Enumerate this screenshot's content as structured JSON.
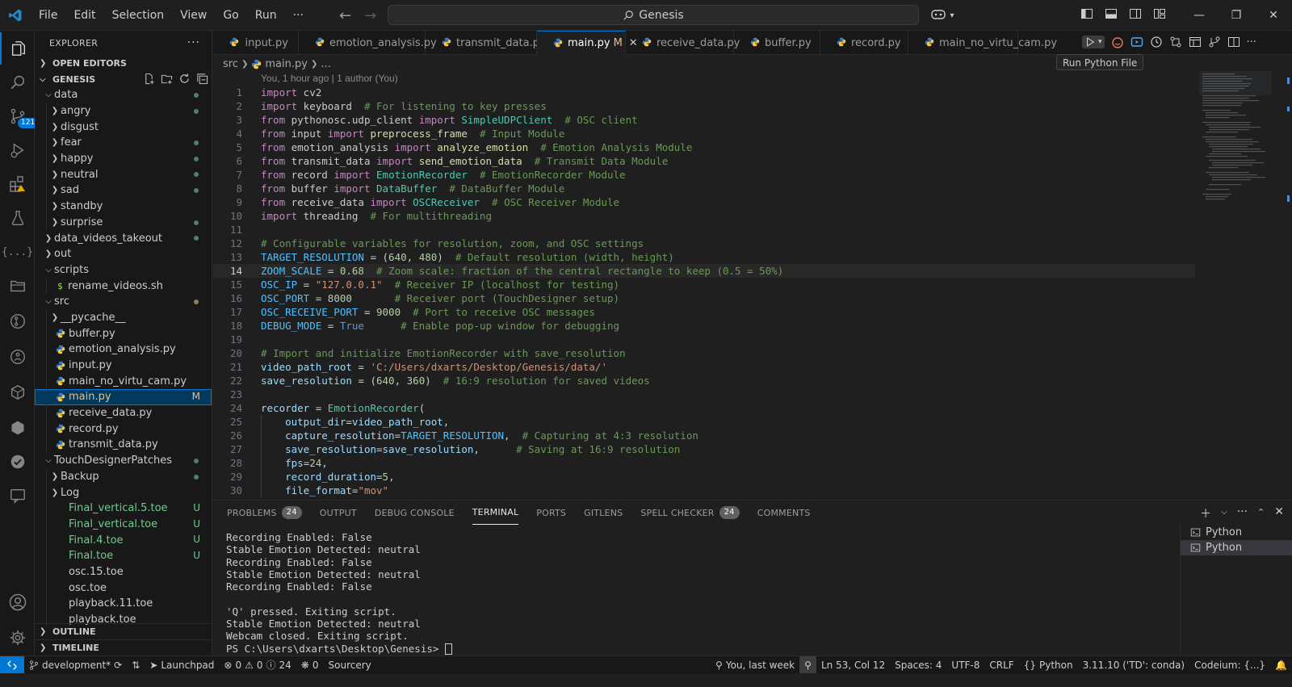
{
  "titlebar": {
    "menu": [
      "File",
      "Edit",
      "Selection",
      "View",
      "Go",
      "Run",
      "···"
    ],
    "search_text": "Genesis"
  },
  "activity": {
    "scm_badge": "121"
  },
  "explorer": {
    "header": "EXPLORER",
    "open_editors": "OPEN EDITORS",
    "root": "GENESIS",
    "tree": [
      {
        "label": "data",
        "depth": 0,
        "type": "folder-open",
        "status": "dot"
      },
      {
        "label": "angry",
        "depth": 1,
        "type": "folder",
        "status": "dot"
      },
      {
        "label": "disgust",
        "depth": 1,
        "type": "folder",
        "status": ""
      },
      {
        "label": "fear",
        "depth": 1,
        "type": "folder",
        "status": "dot"
      },
      {
        "label": "happy",
        "depth": 1,
        "type": "folder",
        "status": "dot"
      },
      {
        "label": "neutral",
        "depth": 1,
        "type": "folder",
        "status": "dot"
      },
      {
        "label": "sad",
        "depth": 1,
        "type": "folder",
        "status": "dot"
      },
      {
        "label": "standby",
        "depth": 1,
        "type": "folder",
        "status": ""
      },
      {
        "label": "surprise",
        "depth": 1,
        "type": "folder",
        "status": "dot"
      },
      {
        "label": "data_videos_takeout",
        "depth": 0,
        "type": "folder",
        "status": "dot"
      },
      {
        "label": "out",
        "depth": 0,
        "type": "folder",
        "status": ""
      },
      {
        "label": "scripts",
        "depth": 0,
        "type": "folder-open",
        "status": ""
      },
      {
        "label": "rename_videos.sh",
        "depth": 1,
        "type": "sh",
        "status": ""
      },
      {
        "label": "src",
        "depth": 0,
        "type": "folder-open",
        "status": "dotmod"
      },
      {
        "label": "__pycache__",
        "depth": 1,
        "type": "folder",
        "status": ""
      },
      {
        "label": "buffer.py",
        "depth": 1,
        "type": "py",
        "status": ""
      },
      {
        "label": "emotion_analysis.py",
        "depth": 1,
        "type": "py",
        "status": ""
      },
      {
        "label": "input.py",
        "depth": 1,
        "type": "py",
        "status": ""
      },
      {
        "label": "main_no_virtu_cam.py",
        "depth": 1,
        "type": "py",
        "status": ""
      },
      {
        "label": "main.py",
        "depth": 1,
        "type": "py",
        "status": "M",
        "selected": true
      },
      {
        "label": "receive_data.py",
        "depth": 1,
        "type": "py",
        "status": ""
      },
      {
        "label": "record.py",
        "depth": 1,
        "type": "py",
        "status": ""
      },
      {
        "label": "transmit_data.py",
        "depth": 1,
        "type": "py",
        "status": ""
      },
      {
        "label": "TouchDesignerPatches",
        "depth": 0,
        "type": "folder-open",
        "status": "dot"
      },
      {
        "label": "Backup",
        "depth": 1,
        "type": "folder",
        "status": "dot"
      },
      {
        "label": "Log",
        "depth": 1,
        "type": "folder",
        "status": ""
      },
      {
        "label": "Final_vertical.5.toe",
        "depth": 1,
        "type": "file-green",
        "status": "U"
      },
      {
        "label": "Final_vertical.toe",
        "depth": 1,
        "type": "file-green",
        "status": "U"
      },
      {
        "label": "Final.4.toe",
        "depth": 1,
        "type": "file-green",
        "status": "U"
      },
      {
        "label": "Final.toe",
        "depth": 1,
        "type": "file-green",
        "status": "U"
      },
      {
        "label": "osc.15.toe",
        "depth": 1,
        "type": "file",
        "status": ""
      },
      {
        "label": "osc.toe",
        "depth": 1,
        "type": "file",
        "status": ""
      },
      {
        "label": "playback.11.toe",
        "depth": 1,
        "type": "file",
        "status": ""
      },
      {
        "label": "playback.toe",
        "depth": 1,
        "type": "file",
        "status": ""
      }
    ],
    "outline": "OUTLINE",
    "timeline": "TIMELINE"
  },
  "tabs": [
    {
      "label": "input.py",
      "active": false,
      "modified": ""
    },
    {
      "label": "emotion_analysis.py",
      "active": false,
      "modified": ""
    },
    {
      "label": "transmit_data.py",
      "active": false,
      "modified": ""
    },
    {
      "label": "main.py",
      "active": true,
      "modified": "M"
    },
    {
      "label": "receive_data.py",
      "active": false,
      "modified": ""
    },
    {
      "label": "buffer.py",
      "active": false,
      "modified": ""
    },
    {
      "label": "record.py",
      "active": false,
      "modified": ""
    },
    {
      "label": "main_no_virtu_cam.py",
      "active": false,
      "modified": ""
    }
  ],
  "tooltip": "Run Python File",
  "breadcrumb": {
    "folder": "src",
    "file": "main.py",
    "more": "..."
  },
  "blame": "You, 1 hour ago | 1 author (You)",
  "code": [
    {
      "n": "1",
      "t": [
        [
          "kw",
          "import"
        ],
        [
          "",
          " cv2"
        ]
      ]
    },
    {
      "n": "2",
      "t": [
        [
          "kw",
          "import"
        ],
        [
          "",
          " keyboard  "
        ],
        [
          "cm",
          "# For listening to key presses"
        ]
      ]
    },
    {
      "n": "3",
      "t": [
        [
          "kw",
          "from"
        ],
        [
          "",
          " pythonosc.udp_client "
        ],
        [
          "kw",
          "import"
        ],
        [
          "",
          " "
        ],
        [
          "cls",
          "SimpleUDPClient"
        ],
        [
          "",
          "  "
        ],
        [
          "cm",
          "# OSC client"
        ]
      ]
    },
    {
      "n": "4",
      "t": [
        [
          "kw",
          "from"
        ],
        [
          "",
          " input "
        ],
        [
          "kw",
          "import"
        ],
        [
          "",
          " "
        ],
        [
          "fn",
          "preprocess_frame"
        ],
        [
          "",
          "  "
        ],
        [
          "cm",
          "# Input Module"
        ]
      ]
    },
    {
      "n": "5",
      "t": [
        [
          "kw",
          "from"
        ],
        [
          "",
          " emotion_analysis "
        ],
        [
          "kw",
          "import"
        ],
        [
          "",
          " "
        ],
        [
          "fn",
          "analyze_emotion"
        ],
        [
          "",
          "  "
        ],
        [
          "cm",
          "# Emotion Analysis Module"
        ]
      ]
    },
    {
      "n": "6",
      "t": [
        [
          "kw",
          "from"
        ],
        [
          "",
          " transmit_data "
        ],
        [
          "kw",
          "import"
        ],
        [
          "",
          " "
        ],
        [
          "fn",
          "send_emotion_data"
        ],
        [
          "",
          "  "
        ],
        [
          "cm",
          "# Transmit Data Module"
        ]
      ]
    },
    {
      "n": "7",
      "t": [
        [
          "kw",
          "from"
        ],
        [
          "",
          " record "
        ],
        [
          "kw",
          "import"
        ],
        [
          "",
          " "
        ],
        [
          "cls",
          "EmotionRecorder"
        ],
        [
          "",
          "  "
        ],
        [
          "cm",
          "# EmotionRecorder Module"
        ]
      ]
    },
    {
      "n": "8",
      "t": [
        [
          "kw",
          "from"
        ],
        [
          "",
          " buffer "
        ],
        [
          "kw",
          "import"
        ],
        [
          "",
          " "
        ],
        [
          "cls",
          "DataBuffer"
        ],
        [
          "",
          "  "
        ],
        [
          "cm",
          "# DataBuffer Module"
        ]
      ]
    },
    {
      "n": "9",
      "t": [
        [
          "kw",
          "from"
        ],
        [
          "",
          " receive_data "
        ],
        [
          "kw",
          "import"
        ],
        [
          "",
          " "
        ],
        [
          "cls",
          "OSCReceiver"
        ],
        [
          "",
          "  "
        ],
        [
          "cm",
          "# OSC Receiver Module"
        ]
      ]
    },
    {
      "n": "10",
      "t": [
        [
          "kw",
          "import"
        ],
        [
          "",
          " threading  "
        ],
        [
          "cm",
          "# For multithreading"
        ]
      ]
    },
    {
      "n": "11",
      "t": []
    },
    {
      "n": "12",
      "t": [
        [
          "cm",
          "# Configurable variables for resolution, zoom, and OSC settings"
        ]
      ]
    },
    {
      "n": "13",
      "t": [
        [
          "cn",
          "TARGET_RESOLUTION"
        ],
        [
          "",
          " = ("
        ],
        [
          "nm",
          "640"
        ],
        [
          "",
          ", "
        ],
        [
          "nm",
          "480"
        ],
        [
          "",
          ")  "
        ],
        [
          "cm",
          "# Default resolution (width, height)"
        ]
      ]
    },
    {
      "n": "14",
      "t": [
        [
          "cn",
          "ZOOM_SCALE"
        ],
        [
          "",
          " = "
        ],
        [
          "nm",
          "0.68"
        ],
        [
          "",
          "  "
        ],
        [
          "cm",
          "# Zoom scale: fraction of the central rectangle to keep (0.5 = 50%)"
        ]
      ],
      "current": true
    },
    {
      "n": "15",
      "t": [
        [
          "cn",
          "OSC_IP"
        ],
        [
          "",
          " = "
        ],
        [
          "st",
          "\"127.0.0.1\""
        ],
        [
          "",
          "  "
        ],
        [
          "cm",
          "# Receiver IP (localhost for testing)"
        ]
      ]
    },
    {
      "n": "16",
      "t": [
        [
          "cn",
          "OSC_PORT"
        ],
        [
          "",
          " = "
        ],
        [
          "nm",
          "8000"
        ],
        [
          "",
          "       "
        ],
        [
          "cm",
          "# Receiver port (TouchDesigner setup)"
        ]
      ]
    },
    {
      "n": "17",
      "t": [
        [
          "cn",
          "OSC_RECEIVE_PORT"
        ],
        [
          "",
          " = "
        ],
        [
          "nm",
          "9000"
        ],
        [
          "",
          "  "
        ],
        [
          "cm",
          "# Port to receive OSC messages"
        ]
      ]
    },
    {
      "n": "18",
      "t": [
        [
          "cn",
          "DEBUG_MODE"
        ],
        [
          "",
          " = "
        ],
        [
          "bl",
          "True"
        ],
        [
          "",
          "      "
        ],
        [
          "cm",
          "# Enable pop-up window for debugging"
        ]
      ]
    },
    {
      "n": "19",
      "t": []
    },
    {
      "n": "20",
      "t": [
        [
          "cm",
          "# Import and initialize EmotionRecorder with save_resolution"
        ]
      ]
    },
    {
      "n": "21",
      "t": [
        [
          "vr",
          "video_path_root"
        ],
        [
          "",
          " = "
        ],
        [
          "st",
          "'C:/Users/dxarts/Desktop/Genesis/data/'"
        ]
      ]
    },
    {
      "n": "22",
      "t": [
        [
          "vr",
          "save_resolution"
        ],
        [
          "",
          " = ("
        ],
        [
          "nm",
          "640"
        ],
        [
          "",
          ", "
        ],
        [
          "nm",
          "360"
        ],
        [
          "",
          ")  "
        ],
        [
          "cm",
          "# 16:9 resolution for saved videos"
        ]
      ]
    },
    {
      "n": "23",
      "t": []
    },
    {
      "n": "24",
      "t": [
        [
          "vr",
          "recorder"
        ],
        [
          "",
          " = "
        ],
        [
          "cls",
          "EmotionRecorder"
        ],
        [
          "",
          "("
        ]
      ]
    },
    {
      "n": "25",
      "t": [
        [
          "",
          "    "
        ],
        [
          "vr",
          "output_dir"
        ],
        [
          "",
          "="
        ],
        [
          "vr",
          "video_path_root"
        ],
        [
          "",
          ","
        ]
      ]
    },
    {
      "n": "26",
      "t": [
        [
          "",
          "    "
        ],
        [
          "vr",
          "capture_resolution"
        ],
        [
          "",
          "="
        ],
        [
          "cn",
          "TARGET_RESOLUTION"
        ],
        [
          "",
          ",  "
        ],
        [
          "cm",
          "# Capturing at 4:3 resolution"
        ]
      ]
    },
    {
      "n": "27",
      "t": [
        [
          "",
          "    "
        ],
        [
          "vr",
          "save_resolution"
        ],
        [
          "",
          "="
        ],
        [
          "vr",
          "save_resolution"
        ],
        [
          "",
          ",      "
        ],
        [
          "cm",
          "# Saving at 16:9 resolution"
        ]
      ]
    },
    {
      "n": "28",
      "t": [
        [
          "",
          "    "
        ],
        [
          "vr",
          "fps"
        ],
        [
          "",
          "="
        ],
        [
          "nm",
          "24"
        ],
        [
          "",
          ","
        ]
      ]
    },
    {
      "n": "29",
      "t": [
        [
          "",
          "    "
        ],
        [
          "vr",
          "record_duration"
        ],
        [
          "",
          "="
        ],
        [
          "nm",
          "5"
        ],
        [
          "",
          ","
        ]
      ]
    },
    {
      "n": "30",
      "t": [
        [
          "",
          "    "
        ],
        [
          "vr",
          "file_format"
        ],
        [
          "",
          "="
        ],
        [
          "st",
          "\"mov\""
        ]
      ]
    }
  ],
  "panel": {
    "tabs": [
      {
        "label": "PROBLEMS",
        "count": "24"
      },
      {
        "label": "OUTPUT",
        "count": ""
      },
      {
        "label": "DEBUG CONSOLE",
        "count": ""
      },
      {
        "label": "TERMINAL",
        "count": "",
        "active": true
      },
      {
        "label": "PORTS",
        "count": ""
      },
      {
        "label": "GITLENS",
        "count": ""
      },
      {
        "label": "SPELL CHECKER",
        "count": "24"
      },
      {
        "label": "COMMENTS",
        "count": ""
      }
    ],
    "terminal_lines": [
      "Recording Enabled: False",
      "Stable Emotion Detected: neutral",
      "Recording Enabled: False",
      "Stable Emotion Detected: neutral",
      "Recording Enabled: False",
      "",
      "'Q' pressed. Exiting script.",
      "Stable Emotion Detected: neutral",
      "Webcam closed. Exiting script."
    ],
    "prompt": "PS C:\\Users\\dxarts\\Desktop\\Genesis> ",
    "terminals": [
      {
        "label": "Python",
        "active": false
      },
      {
        "label": "Python",
        "active": true
      }
    ]
  },
  "statusbar": {
    "branch": "development*",
    "launchpad": "Launchpad",
    "errors": "0",
    "warnings_a": "0",
    "warnings_b": "24",
    "ports": "0",
    "sourcery": "Sourcery",
    "blame": "You, last week",
    "position": "Ln 53, Col 12",
    "spaces": "Spaces: 4",
    "encoding": "UTF-8",
    "eol": "CRLF",
    "language": "Python",
    "interpreter": "3.11.10 ('TD': conda)",
    "codeium": "Codeium: {...}"
  },
  "colors": {
    "accent": "#0078d4",
    "git_added": "#73c991",
    "git_modified": "#e2c08d"
  }
}
